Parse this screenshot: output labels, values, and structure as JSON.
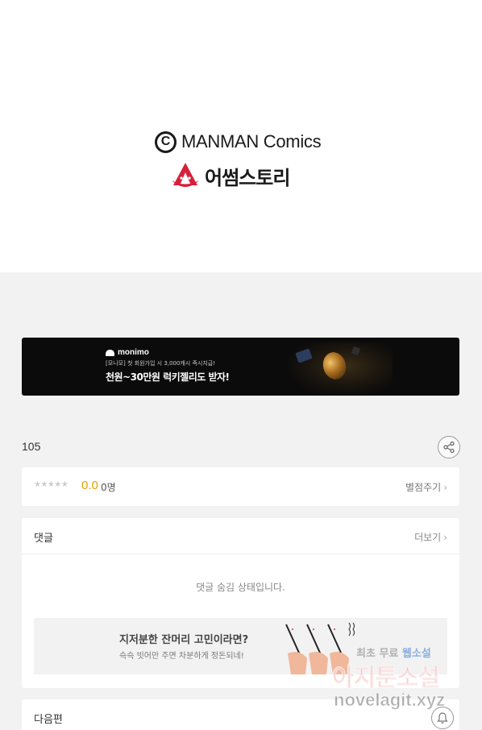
{
  "header": {
    "publisher_logo_text": "MANMAN Comics",
    "copyright_symbol": "C",
    "studio_logo_text": "어썸스토리"
  },
  "banner": {
    "brand": "monimo",
    "subtext": "[모니모] 첫 회원가입 시 3,000캐시 즉시지급!",
    "headline": "천원~30만원 럭키젤리도 받자!"
  },
  "episode": {
    "number": "105"
  },
  "rating": {
    "stars": "★★★★★",
    "score": "0.0",
    "count": "0명",
    "rate_label": "별점주기"
  },
  "comments": {
    "title": "댓글",
    "more_label": "더보기",
    "hidden_message": "댓글 숨김 상태입니다.",
    "ad": {
      "title": "지저분한 잔머리 고민이라면?",
      "subtitle": "슥슥 빗어만 주면 차분하게 정돈되네!"
    }
  },
  "next": {
    "title": "다음편"
  },
  "watermark": {
    "line1_prefix": "최초 무료",
    "line1_highlight": "웹소설",
    "line2": "아지툰소설",
    "line3": "novelagit.xyz"
  },
  "icons": {
    "share": "share-icon",
    "bell": "bell-icon",
    "chevron": "chevron-right-icon"
  },
  "colors": {
    "score": "#e5a000",
    "studio_logo_red": "#d6213c",
    "banner_bg": "#0b0b0b"
  }
}
